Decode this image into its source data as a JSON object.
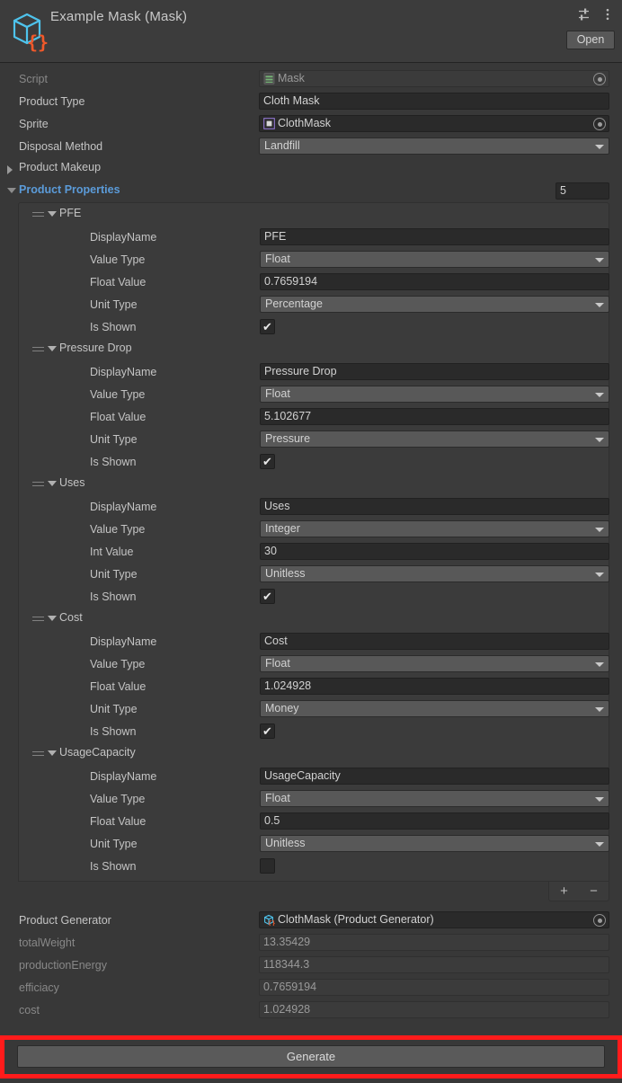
{
  "header": {
    "title": "Example Mask (Mask)",
    "icon": "scriptable-object-cube-icon",
    "preset_icon": "preset-sliders-icon",
    "menu_icon": "kebab-menu-icon",
    "open_label": "Open"
  },
  "top_fields": {
    "script": {
      "label": "Script",
      "value": "Mask",
      "icon": "cs-script-icon",
      "picker": "object-picker-icon"
    },
    "product_type": {
      "label": "Product Type",
      "value": "Cloth Mask"
    },
    "sprite": {
      "label": "Sprite",
      "value": "ClothMask",
      "icon": "sprite-icon",
      "picker": "object-picker-icon"
    },
    "disposal_method": {
      "label": "Disposal Method",
      "value": "Landfill"
    }
  },
  "foldouts": {
    "product_makeup": {
      "label": "Product Makeup",
      "expanded": false
    },
    "product_properties": {
      "label": "Product Properties",
      "expanded": true,
      "array_size": "5",
      "accent_color": "#5b9bd9"
    }
  },
  "labels": {
    "display_name": "DisplayName",
    "value_type": "Value Type",
    "float_value": "Float Value",
    "int_value": "Int Value",
    "unit_type": "Unit Type",
    "is_shown": "Is Shown"
  },
  "properties": [
    {
      "name": "PFE",
      "display_name": "PFE",
      "value_type": "Float",
      "value_label": "Float Value",
      "value": "0.7659194",
      "unit_type": "Percentage",
      "is_shown": true
    },
    {
      "name": "Pressure Drop",
      "display_name": "Pressure Drop",
      "value_type": "Float",
      "value_label": "Float Value",
      "value": "5.102677",
      "unit_type": "Pressure",
      "is_shown": true
    },
    {
      "name": "Uses",
      "display_name": "Uses",
      "value_type": "Integer",
      "value_label": "Int Value",
      "value": "30",
      "unit_type": "Unitless",
      "is_shown": true
    },
    {
      "name": "Cost",
      "display_name": "Cost",
      "value_type": "Float",
      "value_label": "Float Value",
      "value": "1.024928",
      "unit_type": "Money",
      "is_shown": true
    },
    {
      "name": "UsageCapacity",
      "display_name": "UsageCapacity",
      "value_type": "Float",
      "value_label": "Float Value",
      "value": "0.5",
      "unit_type": "Unitless",
      "is_shown": false
    }
  ],
  "list_footer": {
    "add_label": "+",
    "remove_label": "−"
  },
  "bottom_fields": {
    "product_generator": {
      "label": "Product Generator",
      "value": "ClothMask (Product Generator)",
      "icon": "scriptable-object-cube-icon",
      "picker": "object-picker-icon"
    },
    "readonly": [
      {
        "label": "totalWeight",
        "value": "13.35429"
      },
      {
        "label": "productionEnergy",
        "value": "118344.3"
      },
      {
        "label": "efficiacy",
        "value": "0.7659194"
      },
      {
        "label": "cost",
        "value": "1.024928"
      }
    ]
  },
  "generate_button": {
    "label": "Generate",
    "highlight_color": "#ff1b1b"
  }
}
